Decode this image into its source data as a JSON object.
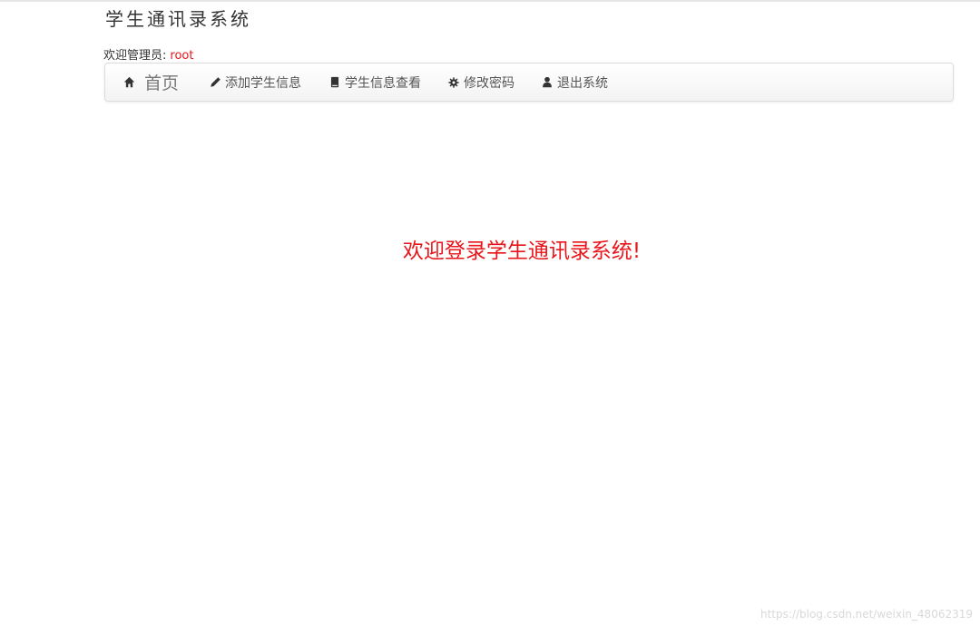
{
  "app": {
    "title": "学生通讯录系统"
  },
  "welcome": {
    "label": "欢迎管理员:",
    "username": "root"
  },
  "navbar": {
    "brand": {
      "label": "首页",
      "icon": "home-icon"
    },
    "items": [
      {
        "label": "添加学生信息",
        "icon": "pencil-icon"
      },
      {
        "label": "学生信息查看",
        "icon": "book-icon"
      },
      {
        "label": "修改密码",
        "icon": "gear-icon"
      },
      {
        "label": "退出系统",
        "icon": "user-icon"
      }
    ]
  },
  "main": {
    "message": "欢迎登录学生通讯录系统!"
  },
  "footer": {
    "watermark": "https://blog.csdn.net/weixin_48062319"
  },
  "colors": {
    "accent_red": "#e8161a",
    "nav_text": "#555555",
    "nav_border": "#dcdcdc"
  }
}
